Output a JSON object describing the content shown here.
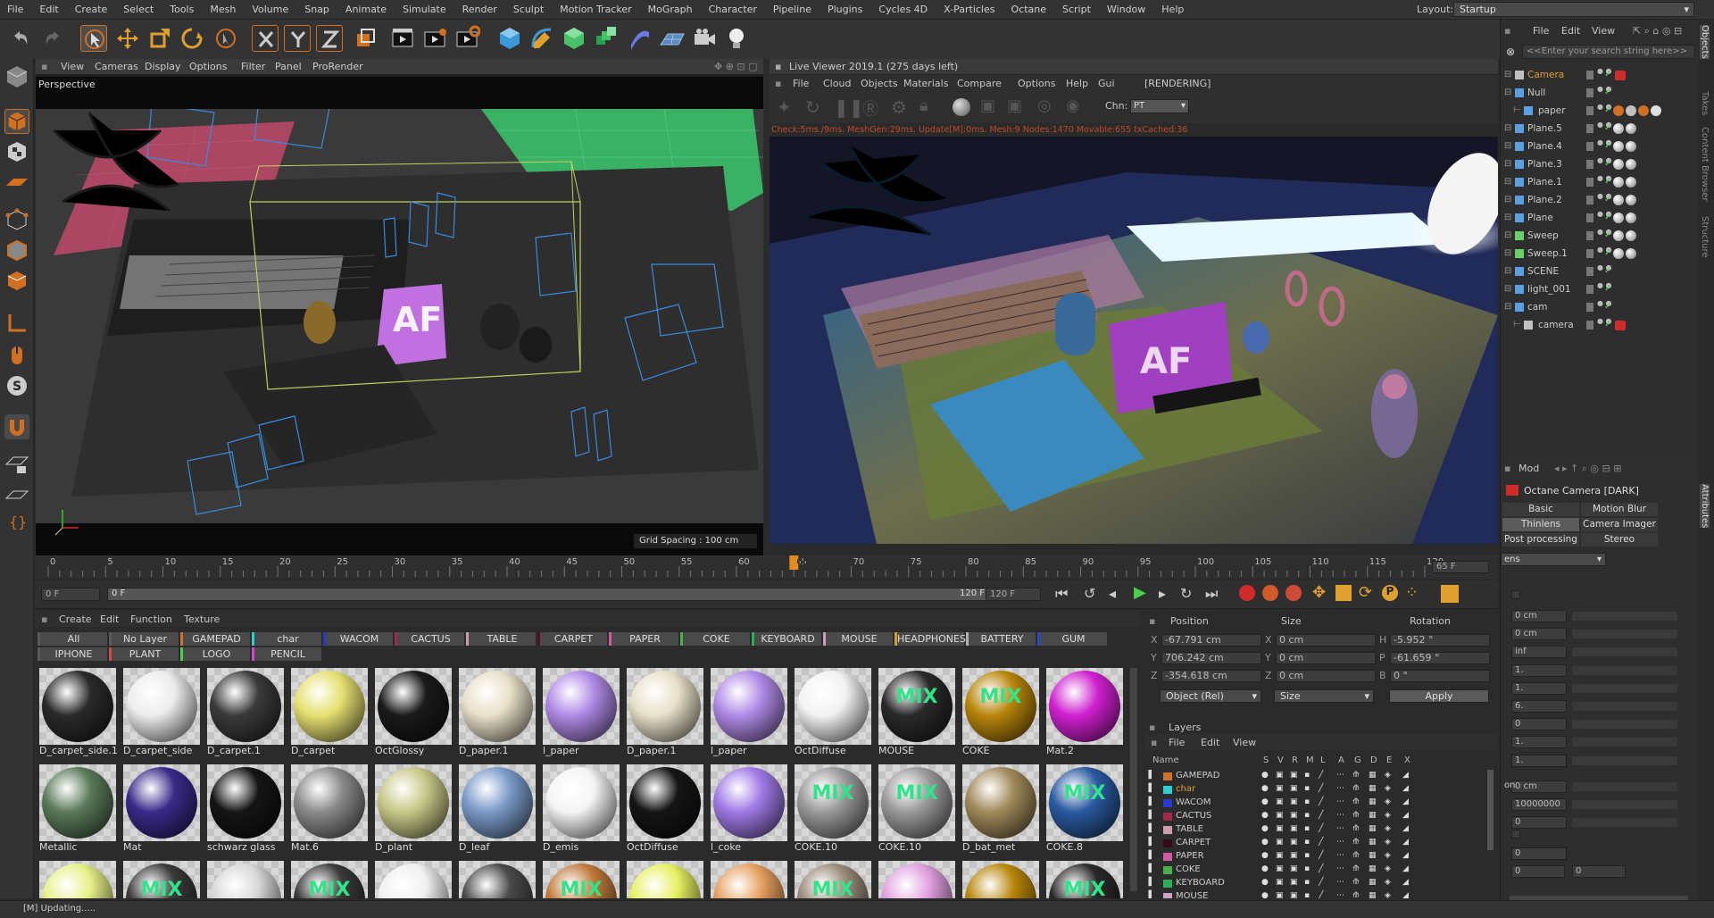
{
  "menubar": {
    "items": [
      "File",
      "Edit",
      "Create",
      "Select",
      "Tools",
      "Mesh",
      "Volume",
      "Snap",
      "Animate",
      "Simulate",
      "Render",
      "Sculpt",
      "Motion Tracker",
      "MoGraph",
      "Character",
      "Pipeline",
      "Plugins",
      "Cycles 4D",
      "X-Particles",
      "Octane",
      "Script",
      "Window",
      "Help"
    ],
    "layout_label": "Layout:",
    "layout_value": "Startup"
  },
  "viewport": {
    "menu": [
      "View",
      "Cameras",
      "Display",
      "Options",
      "Filter",
      "Panel",
      "ProRender"
    ],
    "label": "Perspective",
    "grid_spacing": "Grid Spacing : 100 cm"
  },
  "live_viewer": {
    "title": "Live Viewer 2019.1 (275 days left)",
    "menu": [
      "File",
      "Cloud",
      "Objects",
      "Materials",
      "Compare",
      "Options",
      "Help",
      "Gui"
    ],
    "status": "[RENDERING]",
    "channel_label": "Chn:",
    "channel_value": "PT",
    "info": "Check:5ms./9ms. MeshGen:29ms. Update[M]:0ms. Mesh:9 Nodes:1470 Movable:655 txCached:36"
  },
  "timeline": {
    "ticks": [
      "0",
      "5",
      "10",
      "15",
      "20",
      "25",
      "30",
      "35",
      "40",
      "45",
      "50",
      "55",
      "60",
      "65",
      "70",
      "75",
      "80",
      "85",
      "90",
      "95",
      "100",
      "105",
      "110",
      "115",
      "120"
    ],
    "current_frame": "65",
    "current_frame_field": "65 F",
    "playhead_fraction": 0.5417
  },
  "transport": {
    "start_field": "0 F",
    "range_start": "0 F",
    "range_end": "120 F",
    "end_field": "120 F"
  },
  "material_manager": {
    "menu": [
      "Create",
      "Edit",
      "Function",
      "Texture"
    ],
    "filters_row1": [
      {
        "label": "All",
        "color": "#5a5a5a"
      },
      {
        "label": "No Layer",
        "color": "#5a5a5a"
      },
      {
        "label": "GAMEPAD",
        "color": "#d0702a"
      },
      {
        "label": "char",
        "color": "#2ad0d0"
      },
      {
        "label": "WACOM",
        "color": "#2a3ad0"
      },
      {
        "label": "CACTUS",
        "color": "#a02a4a"
      },
      {
        "label": "TABLE",
        "color": "#d09ab0"
      },
      {
        "label": "CARPET",
        "color": "#5a0a2a"
      },
      {
        "label": "PAPER",
        "color": "#d05aa0"
      },
      {
        "label": "COKE",
        "color": "#4ab04a"
      },
      {
        "label": "KEYBOARD",
        "color": "#2ab05a"
      },
      {
        "label": "MOUSE",
        "color": "#d0a0c0"
      },
      {
        "label": "HEADPHONES",
        "color": "#d0a02a"
      },
      {
        "label": "BATTERY",
        "color": "#b0b0b0"
      },
      {
        "label": "GUM",
        "color": "#2a4ad0"
      }
    ],
    "filters_row2": [
      {
        "label": "IPHONE",
        "color": "#5a5a5a"
      },
      {
        "label": "PLANT",
        "color": "#d04a4a"
      },
      {
        "label": "LOGO",
        "color": "#4ad04a"
      },
      {
        "label": "PENCIL",
        "color": "#d04ad0"
      }
    ],
    "materials": [
      {
        "name": "D_carpet_side.1",
        "color": "#2a2a2a",
        "mix": false
      },
      {
        "name": "D_carpet_side",
        "color": "#ececec",
        "mix": false
      },
      {
        "name": "D_carpet.1",
        "color": "#3a3a3a",
        "mix": false
      },
      {
        "name": "D_carpet",
        "color": "#e6e070",
        "mix": false
      },
      {
        "name": "OctGlossy",
        "color": "#1a1a1a",
        "mix": false
      },
      {
        "name": "D_paper.1",
        "color": "#e8e0c8",
        "mix": false
      },
      {
        "name": "l_paper",
        "color": "#b08ae6",
        "mix": false
      },
      {
        "name": "D_paper.1",
        "color": "#e8e0c8",
        "mix": false
      },
      {
        "name": "l_paper",
        "color": "#b08ae6",
        "mix": false
      },
      {
        "name": "OctDiffuse",
        "color": "#f2f2f2",
        "mix": false
      },
      {
        "name": "MOUSE",
        "color": "#2a2a2a",
        "mix": true
      },
      {
        "name": "COKE",
        "color": "#b8860b",
        "mix": true
      },
      {
        "name": "Mat.2",
        "color": "#d020d0",
        "mix": false
      },
      {
        "name": "Metallic",
        "color": "#5a7a5a",
        "mix": false
      },
      {
        "name": "Mat",
        "color": "#3a2a8a",
        "mix": false
      },
      {
        "name": "schwarz glass",
        "color": "#151515",
        "mix": false
      },
      {
        "name": "Mat.6",
        "color": "#8a8a8a",
        "mix": false
      },
      {
        "name": "D_plant",
        "color": "#c8c888",
        "mix": false
      },
      {
        "name": "D_leaf",
        "color": "#7a9ac8",
        "mix": false
      },
      {
        "name": "D_emis",
        "color": "#f4f4f4",
        "mix": false
      },
      {
        "name": "OctDiffuse",
        "color": "#151515",
        "mix": false
      },
      {
        "name": "l_coke",
        "color": "#a07ae6",
        "mix": false
      },
      {
        "name": "COKE.10",
        "color": "#9a9a9a",
        "mix": true
      },
      {
        "name": "COKE.10",
        "color": "#9a9a9a",
        "mix": true
      },
      {
        "name": "D_bat_met",
        "color": "#a08a5a",
        "mix": false
      },
      {
        "name": "COKE.8",
        "color": "#2a5aa0",
        "mix": true
      },
      {
        "name": "",
        "color": "#e6f088",
        "mix": false
      },
      {
        "name": "",
        "color": "#3a3a3a",
        "mix": true
      },
      {
        "name": "",
        "color": "#d8d8d8",
        "mix": false
      },
      {
        "name": "",
        "color": "#3a3a3a",
        "mix": true
      },
      {
        "name": "",
        "color": "#f0f0f0",
        "mix": false
      },
      {
        "name": "",
        "color": "#4a4a4a",
        "mix": false
      },
      {
        "name": "",
        "color": "#c07a3a",
        "mix": true
      },
      {
        "name": "",
        "color": "#e6f060",
        "mix": false
      },
      {
        "name": "",
        "color": "#e6a060",
        "mix": false
      },
      {
        "name": "",
        "color": "#9a8a7a",
        "mix": true
      },
      {
        "name": "",
        "color": "#e0a0e0",
        "mix": false
      },
      {
        "name": "",
        "color": "#b8860b",
        "mix": false
      },
      {
        "name": "",
        "color": "#2a2a2a",
        "mix": true
      }
    ]
  },
  "coordinates": {
    "headers": [
      "Position",
      "Size",
      "Rotation"
    ],
    "rows": [
      {
        "axis": "X",
        "pos": "-67.791 cm",
        "saxis": "X",
        "size": "0 cm",
        "raxis": "H",
        "rot": "-5.952 °"
      },
      {
        "axis": "Y",
        "pos": "706.242 cm",
        "saxis": "Y",
        "size": "0 cm",
        "raxis": "P",
        "rot": "-61.659 °"
      },
      {
        "axis": "Z",
        "pos": "-354.618 cm",
        "saxis": "Z",
        "size": "0 cm",
        "raxis": "B",
        "rot": "0 °"
      }
    ],
    "mode_value": "Object (Rel)",
    "size_value": "Size",
    "apply_label": "Apply"
  },
  "layers": {
    "title": "Layers",
    "menu": [
      "File",
      "Edit",
      "View"
    ],
    "columns": [
      "Name",
      "S",
      "V",
      "R",
      "M",
      "L",
      "A",
      "G",
      "D",
      "E",
      "X"
    ],
    "rows": [
      {
        "name": "GAMEPAD",
        "color": "#d0702a"
      },
      {
        "name": "char",
        "color": "#2ad0d0"
      },
      {
        "name": "WACOM",
        "color": "#2a3ad0"
      },
      {
        "name": "CACTUS",
        "color": "#a02a4a"
      },
      {
        "name": "TABLE",
        "color": "#d09ab0"
      },
      {
        "name": "CARPET",
        "color": "#3a0a1a"
      },
      {
        "name": "PAPER",
        "color": "#d05aa0"
      },
      {
        "name": "COKE",
        "color": "#4ab04a"
      },
      {
        "name": "KEYBOARD",
        "color": "#2ab05a"
      },
      {
        "name": "MOUSE",
        "color": "#d0a0c0"
      }
    ]
  },
  "object_manager": {
    "menu": [
      "File",
      "Edit",
      "View"
    ],
    "search_placeholder": "<<Enter your search string here>>",
    "objects": [
      {
        "name": "Camera",
        "indent": 0,
        "highlight": true
      },
      {
        "name": "Null",
        "indent": 0,
        "highlight": false
      },
      {
        "name": "paper",
        "indent": 1,
        "highlight": false
      },
      {
        "name": "Plane.5",
        "indent": 0,
        "highlight": false
      },
      {
        "name": "Plane.4",
        "indent": 0,
        "highlight": false
      },
      {
        "name": "Plane.3",
        "indent": 0,
        "highlight": false
      },
      {
        "name": "Plane.1",
        "indent": 0,
        "highlight": false
      },
      {
        "name": "Plane.2",
        "indent": 0,
        "highlight": false
      },
      {
        "name": "Plane",
        "indent": 0,
        "highlight": false
      },
      {
        "name": "Sweep",
        "indent": 0,
        "highlight": false
      },
      {
        "name": "Sweep.1",
        "indent": 0,
        "highlight": false
      },
      {
        "name": "SCENE",
        "indent": 0,
        "highlight": false
      },
      {
        "name": "light_001",
        "indent": 0,
        "highlight": false
      },
      {
        "name": "cam",
        "indent": 0,
        "highlight": false
      },
      {
        "name": "camera",
        "indent": 1,
        "highlight": false
      }
    ]
  },
  "attribute_manager": {
    "mode_label": "Mod",
    "object_title": "Octane Camera [DARK]",
    "tabs": [
      "Basic",
      "Motion Blur",
      "Thinlens",
      "Camera Imager",
      "Post processing",
      "Stereo"
    ],
    "lens_value": "ens",
    "fields": [
      "0 cm",
      "0 cm",
      "inf",
      "1.",
      "1.",
      "6.",
      "0",
      "1.",
      "1.",
      "0 cm",
      "10000000",
      "0",
      "0",
      "0",
      "0"
    ],
    "on_label": "on"
  },
  "side_tabs": [
    "Objects",
    "Takes",
    "Content Browser",
    "Structure",
    "Attributes"
  ],
  "status": {
    "text": "[M]  Updating....."
  }
}
